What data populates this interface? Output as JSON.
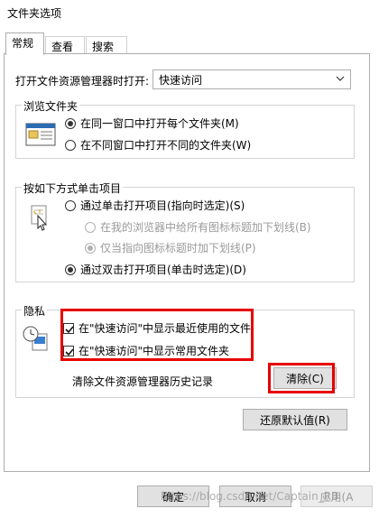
{
  "window": {
    "title": "文件夹选项"
  },
  "tabs": [
    {
      "label": "常规"
    },
    {
      "label": "查看"
    },
    {
      "label": "搜索"
    }
  ],
  "general": {
    "open_explorer_label": "打开文件资源管理器时打开:",
    "open_explorer_value": "快速访问",
    "browse_group": {
      "title": "浏览文件夹",
      "options": [
        {
          "label": "在同一窗口中打开每个文件夹(M)",
          "selected": true
        },
        {
          "label": "在不同窗口中打开不同的文件夹(W)",
          "selected": false
        }
      ]
    },
    "click_group": {
      "title": "按如下方式单击项目",
      "options": [
        {
          "label": "通过单击打开项目(指向时选定)(S)",
          "selected": false
        },
        {
          "label": "在我的浏览器中给所有图标标题加下划线(B)",
          "selected": false,
          "disabled": true
        },
        {
          "label": "仅当指向图标标题时加下划线(P)",
          "selected": true,
          "disabled": true
        },
        {
          "label": "通过双击打开项目(单击时选定)(D)",
          "selected": true
        }
      ]
    },
    "privacy_group": {
      "title": "隐私",
      "checks": [
        {
          "label": "在\"快速访问\"中显示最近使用的文件",
          "checked": true
        },
        {
          "label": "在\"快速访问\"中显示常用文件夹",
          "checked": true
        }
      ],
      "clear_label": "清除文件资源管理器历史记录",
      "clear_button": "清除(C)"
    },
    "restore_button": "还原默认值(R)"
  },
  "footer": {
    "ok_button": "确定",
    "cancel_button": "取消",
    "apply_button": "应用(A"
  },
  "watermark": "https://blog.csdn.net/Captain_RB",
  "colors": {
    "highlight": "#e60000"
  }
}
